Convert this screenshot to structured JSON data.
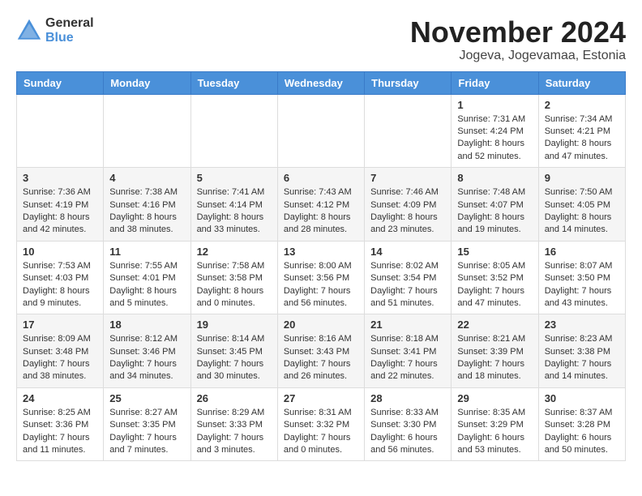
{
  "header": {
    "logo": {
      "general": "General",
      "blue": "Blue"
    },
    "title": "November 2024",
    "location": "Jogeva, Jogevamaa, Estonia"
  },
  "days_of_week": [
    "Sunday",
    "Monday",
    "Tuesday",
    "Wednesday",
    "Thursday",
    "Friday",
    "Saturday"
  ],
  "weeks": [
    [
      {
        "day": "",
        "content": ""
      },
      {
        "day": "",
        "content": ""
      },
      {
        "day": "",
        "content": ""
      },
      {
        "day": "",
        "content": ""
      },
      {
        "day": "",
        "content": ""
      },
      {
        "day": "1",
        "content": "Sunrise: 7:31 AM\nSunset: 4:24 PM\nDaylight: 8 hours and 52 minutes."
      },
      {
        "day": "2",
        "content": "Sunrise: 7:34 AM\nSunset: 4:21 PM\nDaylight: 8 hours and 47 minutes."
      }
    ],
    [
      {
        "day": "3",
        "content": "Sunrise: 7:36 AM\nSunset: 4:19 PM\nDaylight: 8 hours and 42 minutes."
      },
      {
        "day": "4",
        "content": "Sunrise: 7:38 AM\nSunset: 4:16 PM\nDaylight: 8 hours and 38 minutes."
      },
      {
        "day": "5",
        "content": "Sunrise: 7:41 AM\nSunset: 4:14 PM\nDaylight: 8 hours and 33 minutes."
      },
      {
        "day": "6",
        "content": "Sunrise: 7:43 AM\nSunset: 4:12 PM\nDaylight: 8 hours and 28 minutes."
      },
      {
        "day": "7",
        "content": "Sunrise: 7:46 AM\nSunset: 4:09 PM\nDaylight: 8 hours and 23 minutes."
      },
      {
        "day": "8",
        "content": "Sunrise: 7:48 AM\nSunset: 4:07 PM\nDaylight: 8 hours and 19 minutes."
      },
      {
        "day": "9",
        "content": "Sunrise: 7:50 AM\nSunset: 4:05 PM\nDaylight: 8 hours and 14 minutes."
      }
    ],
    [
      {
        "day": "10",
        "content": "Sunrise: 7:53 AM\nSunset: 4:03 PM\nDaylight: 8 hours and 9 minutes."
      },
      {
        "day": "11",
        "content": "Sunrise: 7:55 AM\nSunset: 4:01 PM\nDaylight: 8 hours and 5 minutes."
      },
      {
        "day": "12",
        "content": "Sunrise: 7:58 AM\nSunset: 3:58 PM\nDaylight: 8 hours and 0 minutes."
      },
      {
        "day": "13",
        "content": "Sunrise: 8:00 AM\nSunset: 3:56 PM\nDaylight: 7 hours and 56 minutes."
      },
      {
        "day": "14",
        "content": "Sunrise: 8:02 AM\nSunset: 3:54 PM\nDaylight: 7 hours and 51 minutes."
      },
      {
        "day": "15",
        "content": "Sunrise: 8:05 AM\nSunset: 3:52 PM\nDaylight: 7 hours and 47 minutes."
      },
      {
        "day": "16",
        "content": "Sunrise: 8:07 AM\nSunset: 3:50 PM\nDaylight: 7 hours and 43 minutes."
      }
    ],
    [
      {
        "day": "17",
        "content": "Sunrise: 8:09 AM\nSunset: 3:48 PM\nDaylight: 7 hours and 38 minutes."
      },
      {
        "day": "18",
        "content": "Sunrise: 8:12 AM\nSunset: 3:46 PM\nDaylight: 7 hours and 34 minutes."
      },
      {
        "day": "19",
        "content": "Sunrise: 8:14 AM\nSunset: 3:45 PM\nDaylight: 7 hours and 30 minutes."
      },
      {
        "day": "20",
        "content": "Sunrise: 8:16 AM\nSunset: 3:43 PM\nDaylight: 7 hours and 26 minutes."
      },
      {
        "day": "21",
        "content": "Sunrise: 8:18 AM\nSunset: 3:41 PM\nDaylight: 7 hours and 22 minutes."
      },
      {
        "day": "22",
        "content": "Sunrise: 8:21 AM\nSunset: 3:39 PM\nDaylight: 7 hours and 18 minutes."
      },
      {
        "day": "23",
        "content": "Sunrise: 8:23 AM\nSunset: 3:38 PM\nDaylight: 7 hours and 14 minutes."
      }
    ],
    [
      {
        "day": "24",
        "content": "Sunrise: 8:25 AM\nSunset: 3:36 PM\nDaylight: 7 hours and 11 minutes."
      },
      {
        "day": "25",
        "content": "Sunrise: 8:27 AM\nSunset: 3:35 PM\nDaylight: 7 hours and 7 minutes."
      },
      {
        "day": "26",
        "content": "Sunrise: 8:29 AM\nSunset: 3:33 PM\nDaylight: 7 hours and 3 minutes."
      },
      {
        "day": "27",
        "content": "Sunrise: 8:31 AM\nSunset: 3:32 PM\nDaylight: 7 hours and 0 minutes."
      },
      {
        "day": "28",
        "content": "Sunrise: 8:33 AM\nSunset: 3:30 PM\nDaylight: 6 hours and 56 minutes."
      },
      {
        "day": "29",
        "content": "Sunrise: 8:35 AM\nSunset: 3:29 PM\nDaylight: 6 hours and 53 minutes."
      },
      {
        "day": "30",
        "content": "Sunrise: 8:37 AM\nSunset: 3:28 PM\nDaylight: 6 hours and 50 minutes."
      }
    ]
  ]
}
